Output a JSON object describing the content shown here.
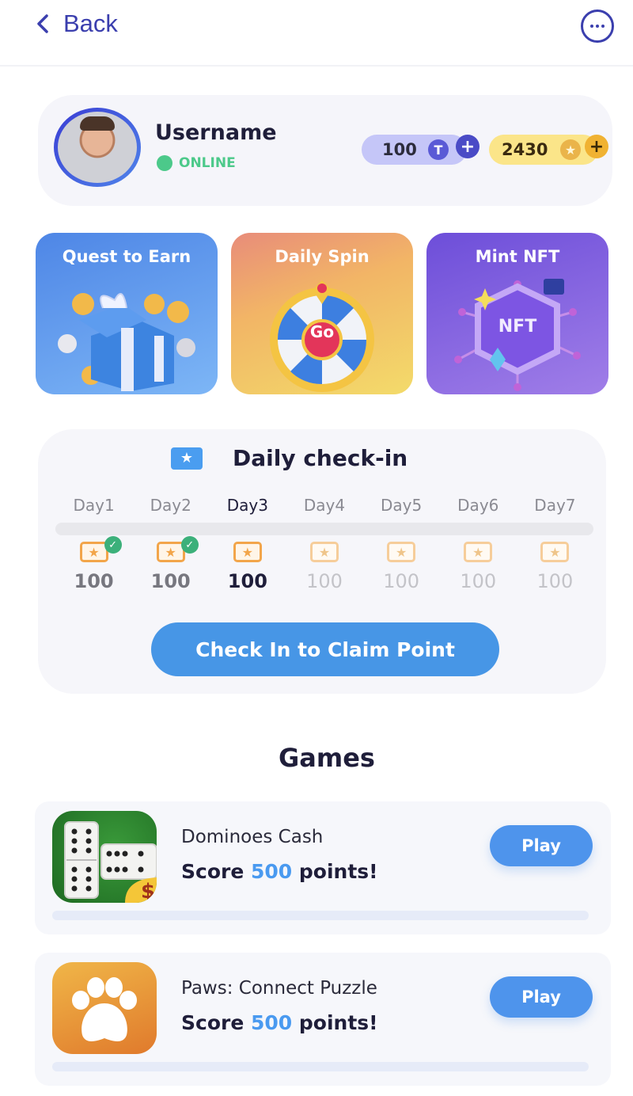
{
  "header": {
    "back_label": "Back",
    "back_icon": "chevron-left-icon",
    "more_icon": "more-horizontal-icon"
  },
  "profile": {
    "username": "Username",
    "status": "ONLINE",
    "status_color": "#4cc98a",
    "token_balance": "100",
    "token_icon_glyph": "T",
    "star_balance": "2430",
    "star_icon_glyph": "★",
    "add_glyph": "+"
  },
  "feature_cards": [
    {
      "title": "Quest to Earn",
      "icon": "gift-box-icon"
    },
    {
      "title": "Daily Spin",
      "icon": "spin-wheel-icon",
      "wheel_label": "Go"
    },
    {
      "title": "Mint NFT",
      "icon": "nft-hexagon-icon",
      "badge_label": "NFT"
    }
  ],
  "checkin": {
    "title": "Daily check-in",
    "icon_glyph": "★",
    "progress_percent": 0,
    "current_day": 3,
    "days": [
      {
        "label": "Day1",
        "points": "100",
        "state": "claimed"
      },
      {
        "label": "Day2",
        "points": "100",
        "state": "claimed"
      },
      {
        "label": "Day3",
        "points": "100",
        "state": "current"
      },
      {
        "label": "Day4",
        "points": "100",
        "state": "future"
      },
      {
        "label": "Day5",
        "points": "100",
        "state": "future"
      },
      {
        "label": "Day6",
        "points": "100",
        "state": "future"
      },
      {
        "label": "Day7",
        "points": "100",
        "state": "future"
      }
    ],
    "ticket_glyph": "★",
    "check_glyph": "✓",
    "button_label": "Check In to Claim Point"
  },
  "games": {
    "title": "Games",
    "items": [
      {
        "name": "Dominoes Cash",
        "goal_prefix": "Score ",
        "goal_value": "500",
        "goal_suffix": " points!",
        "play_label": "Play",
        "progress_percent": 0
      },
      {
        "name": "Paws: Connect Puzzle",
        "goal_prefix": "Score ",
        "goal_value": "500",
        "goal_suffix": " points!",
        "play_label": "Play",
        "progress_percent": 0
      }
    ]
  },
  "colors": {
    "primary": "#3b3fae",
    "accent_blue": "#4796e6",
    "success": "#3cb07a",
    "ticket_orange": "#f2a54a"
  }
}
